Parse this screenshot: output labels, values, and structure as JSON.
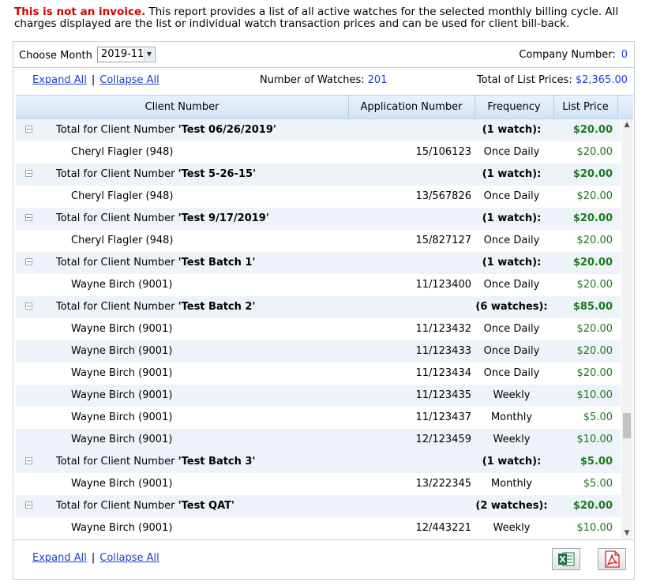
{
  "notice": {
    "warning": "This is not an invoice.",
    "text": " This report provides a list of all active watches for the selected monthly billing cycle. All charges displayed are the list or individual watch transaction prices and can be used for client bill-back."
  },
  "filter": {
    "choose_month_label": "Choose Month",
    "month_value": "2019-11",
    "company_label": "Company Number:",
    "company_value": "0"
  },
  "tools": {
    "expand_all": "Expand All",
    "separator": "|",
    "collapse_all": "Collapse All",
    "watch_count_label": "Number of Watches:",
    "watch_count_value": "201",
    "total_list_label": "Total of List Prices:",
    "total_list_value": "$2,365.00"
  },
  "columns": {
    "client": "Client Number",
    "application": "Application Number",
    "frequency": "Frequency",
    "price": "List Price"
  },
  "groups": [
    {
      "prefix": "Total for Client Number ",
      "name": "'Test 06/26/2019'",
      "count": "(1 watch):",
      "total": "$20.00",
      "items": [
        {
          "client": "Cheryl Flagler (948)",
          "app": "15/106123",
          "freq": "Once Daily",
          "price": "$20.00"
        }
      ]
    },
    {
      "prefix": "Total for Client Number ",
      "name": "'Test 5-26-15'",
      "count": "(1 watch):",
      "total": "$20.00",
      "items": [
        {
          "client": "Cheryl Flagler (948)",
          "app": "13/567826",
          "freq": "Once Daily",
          "price": "$20.00"
        }
      ]
    },
    {
      "prefix": "Total for Client Number ",
      "name": "'Test 9/17/2019'",
      "count": "(1 watch):",
      "total": "$20.00",
      "items": [
        {
          "client": "Cheryl Flagler (948)",
          "app": "15/827127",
          "freq": "Once Daily",
          "price": "$20.00"
        }
      ]
    },
    {
      "prefix": "Total for Client Number ",
      "name": "'Test Batch 1'",
      "count": "(1 watch):",
      "total": "$20.00",
      "items": [
        {
          "client": "Wayne Birch (9001)",
          "app": "11/123400",
          "freq": "Once Daily",
          "price": "$20.00"
        }
      ]
    },
    {
      "prefix": "Total for Client Number ",
      "name": "'Test Batch 2'",
      "count": "(6 watches):",
      "total": "$85.00",
      "items": [
        {
          "client": "Wayne Birch (9001)",
          "app": "11/123432",
          "freq": "Once Daily",
          "price": "$20.00"
        },
        {
          "client": "Wayne Birch (9001)",
          "app": "11/123433",
          "freq": "Once Daily",
          "price": "$20.00"
        },
        {
          "client": "Wayne Birch (9001)",
          "app": "11/123434",
          "freq": "Once Daily",
          "price": "$20.00"
        },
        {
          "client": "Wayne Birch (9001)",
          "app": "11/123435",
          "freq": "Weekly",
          "price": "$10.00"
        },
        {
          "client": "Wayne Birch (9001)",
          "app": "11/123437",
          "freq": "Monthly",
          "price": "$5.00"
        },
        {
          "client": "Wayne Birch (9001)",
          "app": "12/123459",
          "freq": "Weekly",
          "price": "$10.00"
        }
      ]
    },
    {
      "prefix": "Total for Client Number ",
      "name": "'Test Batch 3'",
      "count": "(1 watch):",
      "total": "$5.00",
      "items": [
        {
          "client": "Wayne Birch (9001)",
          "app": "13/222345",
          "freq": "Monthly",
          "price": "$5.00"
        }
      ]
    },
    {
      "prefix": "Total for Client Number ",
      "name": "'Test QAT'",
      "count": "(2 watches):",
      "total": "$20.00",
      "items": [
        {
          "client": "Wayne Birch (9001)",
          "app": "12/443221",
          "freq": "Weekly",
          "price": "$10.00"
        }
      ]
    }
  ],
  "icons": {
    "collapse": "minus-square-icon",
    "excel": "excel-export-icon",
    "pdf": "pdf-export-icon",
    "dropdown": "chevron-down-icon"
  },
  "colors": {
    "warning": "#d40000",
    "link": "#1a3fd0",
    "price": "#1d7a1d",
    "group_row": "#eef3fa",
    "excel_green": "#1e7145",
    "pdf_red": "#d0261d"
  }
}
